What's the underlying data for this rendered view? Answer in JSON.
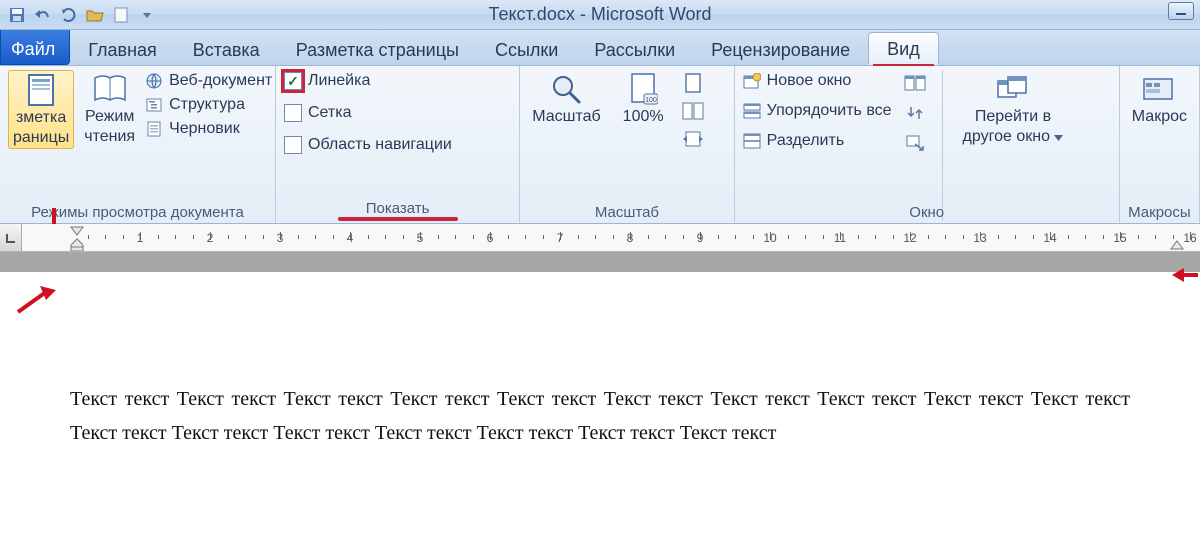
{
  "title": "Текст.docx - Microsoft Word",
  "tabs": {
    "file": "Файл",
    "items": [
      {
        "id": "home",
        "label": "Главная"
      },
      {
        "id": "insert",
        "label": "Вставка"
      },
      {
        "id": "layout",
        "label": "Разметка страницы"
      },
      {
        "id": "refs",
        "label": "Ссылки"
      },
      {
        "id": "mail",
        "label": "Рассылки"
      },
      {
        "id": "review",
        "label": "Рецензирование"
      },
      {
        "id": "view",
        "label": "Вид"
      }
    ],
    "active": "view"
  },
  "ribbon": {
    "views_group_label": "Режимы просмотра документа",
    "views": {
      "print_layout_line1": "зметка",
      "print_layout_line2": "раницы",
      "reading_line1": "Режим",
      "reading_line2": "чтения",
      "web": "Веб-документ",
      "outline": "Структура",
      "draft": "Черновик"
    },
    "show_group_label": "Показать",
    "show": {
      "ruler": "Линейка",
      "grid": "Сетка",
      "nav": "Область навигации"
    },
    "zoom_group_label": "Масштаб",
    "zoom": {
      "zoom": "Масштаб",
      "p100": "100%"
    },
    "window_group_label": "Окно",
    "window": {
      "new": "Новое окно",
      "arrange": "Упорядочить все",
      "split": "Разделить",
      "switch_line1": "Перейти в",
      "switch_line2": "другое окно"
    },
    "macros_group_label": "Макросы",
    "macros_label": "Макрос"
  },
  "ruler": {
    "labels": [
      "1",
      "2",
      "3",
      "4",
      "5",
      "6",
      "7",
      "8",
      "9",
      "10",
      "11",
      "12",
      "13",
      "14",
      "15",
      "16"
    ]
  },
  "document": {
    "line1": "Текст текст Текст текст Текст текст Текст текст Текст текст Текст текст Текст текст Текст текст Текст",
    "line2": "текст Текст текст Текст текст Текст текст Текст текст Текст текст Текст текст Текст текст Текст текст"
  }
}
